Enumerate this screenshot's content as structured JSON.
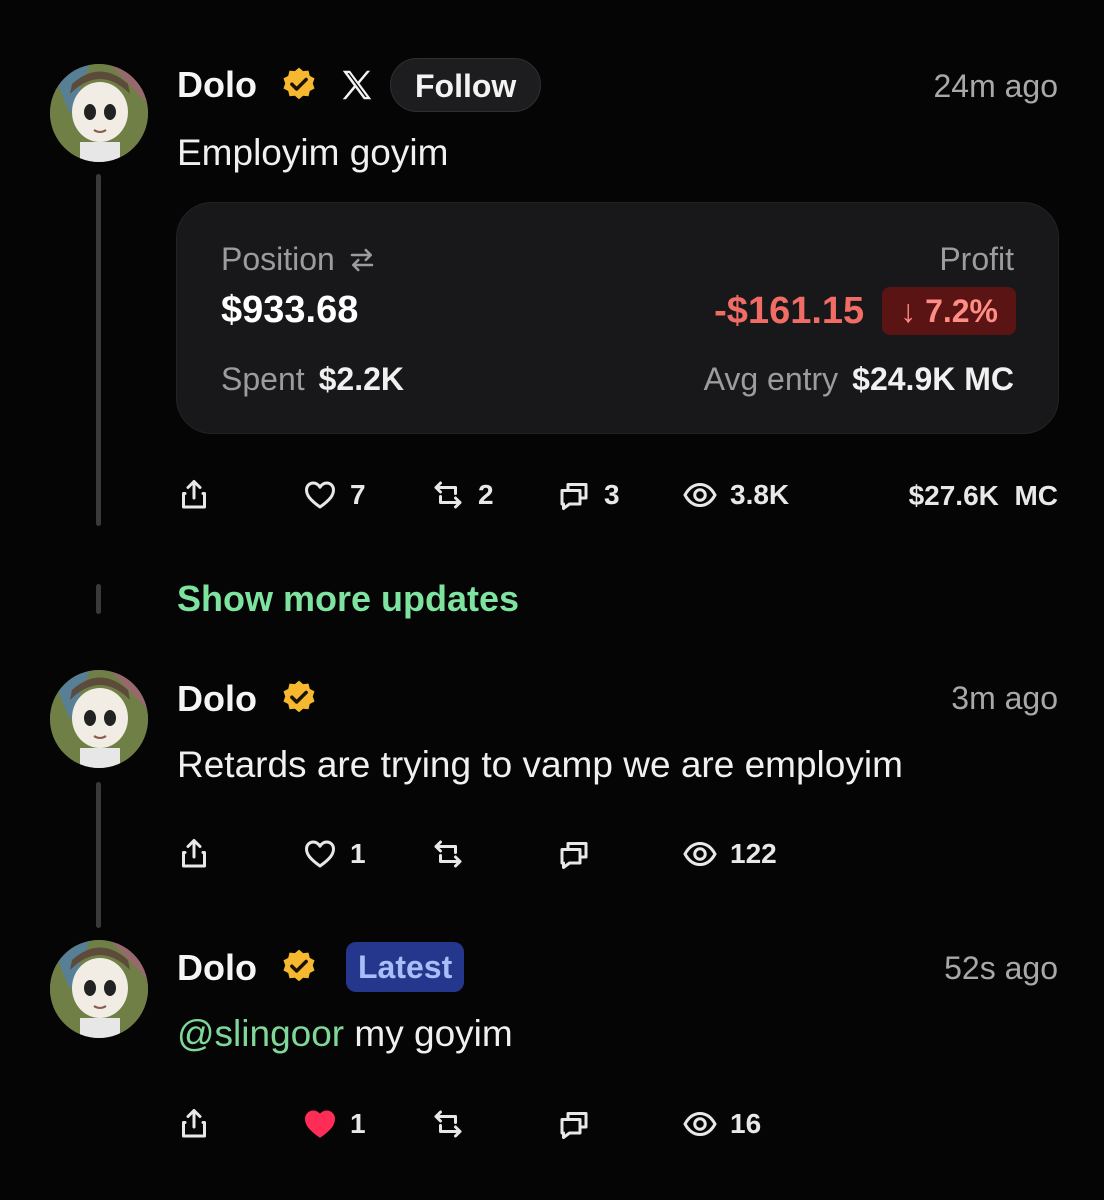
{
  "posts": [
    {
      "author": "Dolo",
      "follow_label": "Follow",
      "time": "24m ago",
      "text": "Employim goyim",
      "card": {
        "position_label": "Position",
        "position_value": "$933.68",
        "profit_label": "Profit",
        "profit_value": "-$161.15",
        "profit_pct": "↓ 7.2%",
        "spent_label": "Spent",
        "spent_value": "$2.2K",
        "avg_label": "Avg entry",
        "avg_value": "$24.9K MC"
      },
      "likes": "7",
      "reposts": "2",
      "comments": "3",
      "views": "3.8K",
      "market_cap": "$27.6K  MC"
    },
    {
      "author": "Dolo",
      "time": "3m ago",
      "text": "Retards are trying to vamp we are employim",
      "likes": "1",
      "views": "122"
    },
    {
      "author": "Dolo",
      "badge_label": "Latest",
      "time": "52s ago",
      "mention": "@slingoor",
      "text": " my goyim",
      "likes": "1",
      "views": "16"
    }
  ],
  "show_more_label": "Show more updates",
  "colors": {
    "background": "#050505",
    "accent_green": "#7fe3a0",
    "loss_red": "#f06c64",
    "verified_gold": "#f5b82e",
    "like_red": "#ff2d55"
  },
  "icons": [
    "share-icon",
    "heart-icon",
    "repost-icon",
    "comment-icon",
    "eye-icon",
    "verified-badge-icon",
    "x-logo-icon",
    "swap-icon"
  ]
}
